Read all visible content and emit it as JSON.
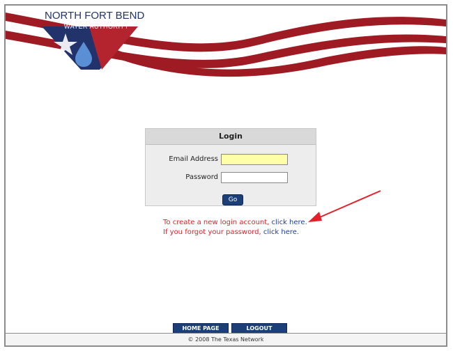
{
  "header": {
    "logo_line1": "NORTH FORT BEND",
    "logo_line2": "WATER AUTHORITY",
    "stripe_color": "#9e1b24",
    "logo_blue": "#22336b"
  },
  "login": {
    "title": "Login",
    "email_label": "Email Address",
    "email_value": "",
    "password_label": "Password",
    "password_value": "",
    "go_label": "Go"
  },
  "notes": {
    "create_text": "To create a new login account, ",
    "create_link": "click here.",
    "forgot_text": "If you forgot your password, ",
    "forgot_link": "click here."
  },
  "footer": {
    "home_label": "HOME PAGE",
    "logout_label": "LOGOUT",
    "copyright": "© 2008 The Texas Network"
  },
  "annotation": {
    "arrow_color": "#e4202a"
  }
}
